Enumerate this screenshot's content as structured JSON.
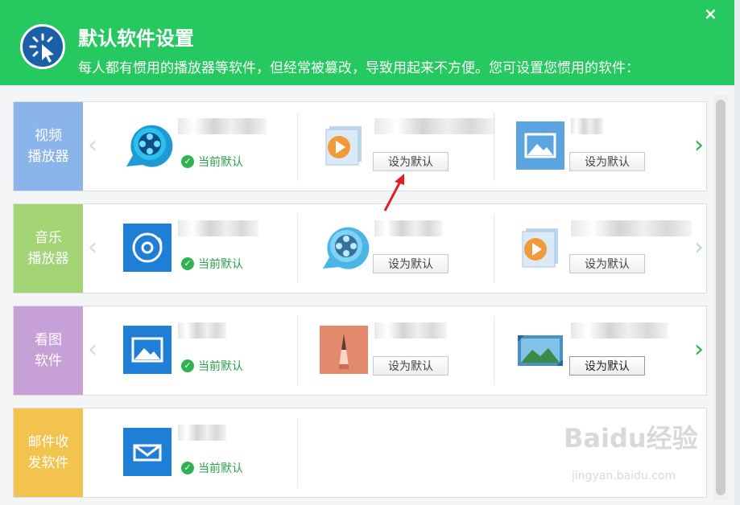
{
  "header": {
    "title": "默认软件设置",
    "subtitle": "每人都有惯用的播放器等软件，但经常被篡改，导致用起来不方便。您可设置您惯用的软件："
  },
  "close_icon": "×",
  "labels": {
    "current_default": "当前默认",
    "set_default": "设为默认"
  },
  "colors": {
    "header_green": "#25c95f",
    "video_cat": "#8ab4ea",
    "music_cat": "#a3d475",
    "image_cat": "#c7a0d8",
    "mail_cat": "#f2c34f",
    "accent_green": "#2ea04a"
  },
  "categories": [
    {
      "label_line1": "视频",
      "label_line2": "播放器",
      "color": "#8ab4ea"
    },
    {
      "label_line1": "音乐",
      "label_line2": "播放器",
      "color": "#a3d475"
    },
    {
      "label_line1": "看图",
      "label_line2": "软件",
      "color": "#c7a0d8"
    },
    {
      "label_line1": "邮件收",
      "label_line2": "发软件",
      "color": "#f2c34f"
    }
  ],
  "icons": {
    "left_arrow": "‹",
    "right_arrow": "›",
    "check": "✓"
  },
  "watermark": {
    "brand": "Baidu经验",
    "url": "jingyan.baidu.com"
  }
}
